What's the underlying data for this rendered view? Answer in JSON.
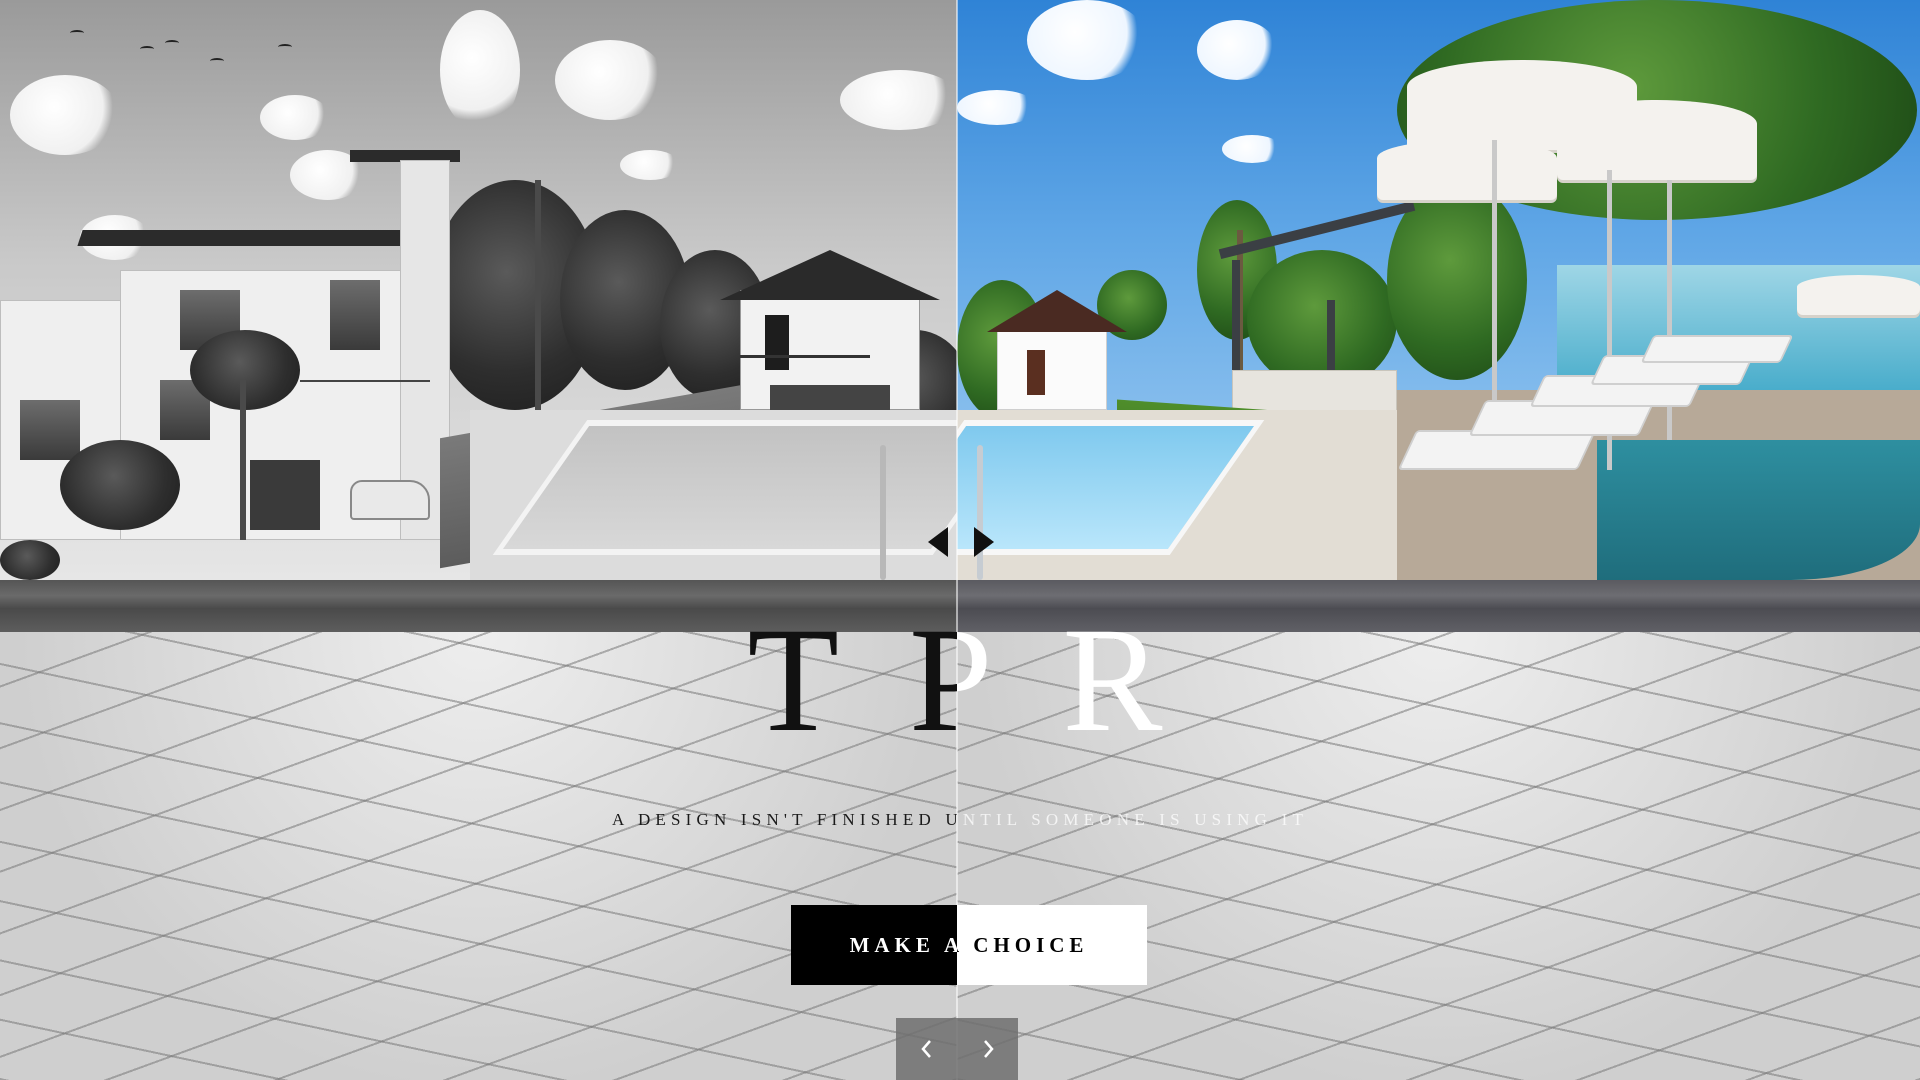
{
  "hero": {
    "brand_title": "TPR",
    "tagline": "A DESIGN ISN'T FINISHED UNTIL SOMEONE IS USING IT",
    "cta_label": "MAKE A CHOICE"
  },
  "compare_slider": {
    "left_image": "black-and-white-villa-and-pool",
    "right_image": "color-resort-pool-with-umbrellas",
    "handle_left_icon": "triangle-left-icon",
    "handle_right_icon": "triangle-right-icon"
  },
  "carousel_nav": {
    "prev_icon": "chevron-left-icon",
    "next_icon": "chevron-right-icon"
  },
  "colors": {
    "cta_dark": "#000000",
    "cta_light": "#ffffff",
    "nav_bg": "#6e6e6e",
    "brand_dark": "#111111",
    "brand_light": "#ffffff"
  }
}
